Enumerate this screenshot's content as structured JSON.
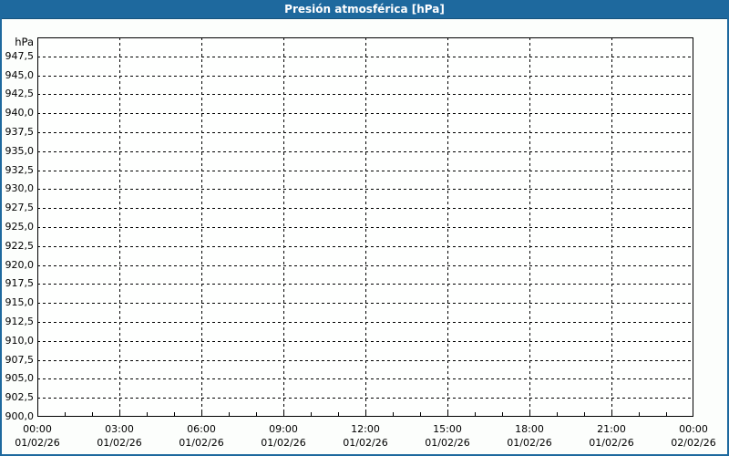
{
  "titlebar": {
    "title": "Presión atmosférica [hPa]"
  },
  "colors": {
    "titlebar_bg": "#1e699e",
    "titlebar_border_bottom": "#17537d",
    "titlebar_text": "#ffffff",
    "window_border": "#1e699e",
    "window_bg": "#fcfefc",
    "plot_bg": "#fefffe",
    "axis_line": "#000000",
    "gridline": "#000000",
    "tick_text": "#000000"
  },
  "chart_data": {
    "type": "line",
    "title": "Presión atmosférica [hPa]",
    "xlabel": "",
    "ylabel": "hPa",
    "ylim": [
      900,
      950
    ],
    "y_tick_step": 2.5,
    "grid": "dashed",
    "legend_position": "none",
    "series": [],
    "y_ticks": [
      {
        "label": "947,5",
        "value": 947.5
      },
      {
        "label": "945,0",
        "value": 945.0
      },
      {
        "label": "942,5",
        "value": 942.5
      },
      {
        "label": "940,0",
        "value": 940.0
      },
      {
        "label": "937,5",
        "value": 937.5
      },
      {
        "label": "935,0",
        "value": 935.0
      },
      {
        "label": "932,5",
        "value": 932.5
      },
      {
        "label": "930,0",
        "value": 930.0
      },
      {
        "label": "927,5",
        "value": 927.5
      },
      {
        "label": "925,0",
        "value": 925.0
      },
      {
        "label": "922,5",
        "value": 922.5
      },
      {
        "label": "920,0",
        "value": 920.0
      },
      {
        "label": "917,5",
        "value": 917.5
      },
      {
        "label": "915,0",
        "value": 915.0
      },
      {
        "label": "912,5",
        "value": 912.5
      },
      {
        "label": "910,0",
        "value": 910.0
      },
      {
        "label": "907,5",
        "value": 907.5
      },
      {
        "label": "905,0",
        "value": 905.0
      },
      {
        "label": "902,5",
        "value": 902.5
      },
      {
        "label": "900,0",
        "value": 900.0
      }
    ],
    "x_axis": {
      "start_hour": 0,
      "end_hour": 24,
      "major_step_hours": 3,
      "minor_step_hours": 1
    },
    "x_ticks": [
      {
        "time": "00:00",
        "date": "01/02/26",
        "hour": 0
      },
      {
        "time": "03:00",
        "date": "01/02/26",
        "hour": 3
      },
      {
        "time": "06:00",
        "date": "01/02/26",
        "hour": 6
      },
      {
        "time": "09:00",
        "date": "01/02/26",
        "hour": 9
      },
      {
        "time": "12:00",
        "date": "01/02/26",
        "hour": 12
      },
      {
        "time": "15:00",
        "date": "01/02/26",
        "hour": 15
      },
      {
        "time": "18:00",
        "date": "01/02/26",
        "hour": 18
      },
      {
        "time": "21:00",
        "date": "01/02/26",
        "hour": 21
      },
      {
        "time": "00:00",
        "date": "02/02/26",
        "hour": 24
      }
    ]
  }
}
